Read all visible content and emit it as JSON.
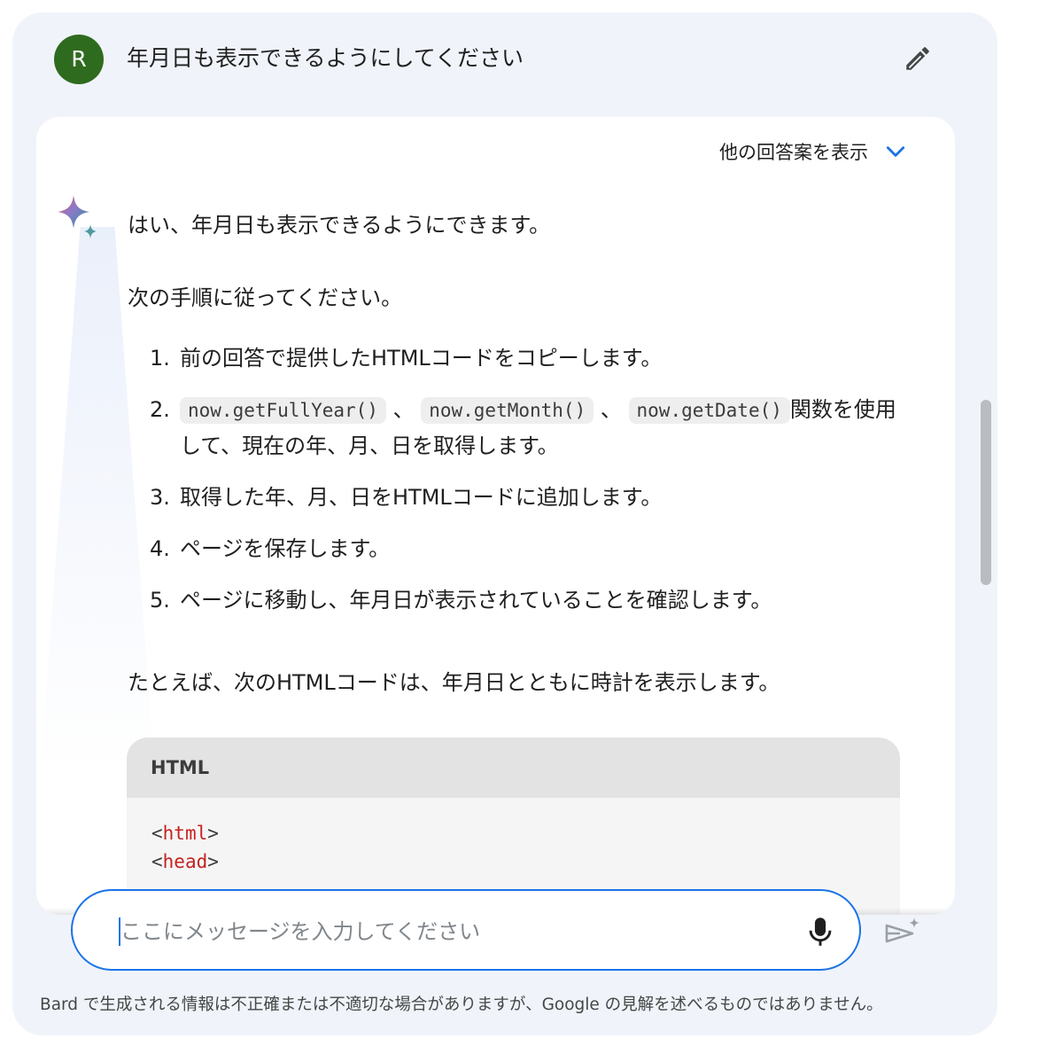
{
  "user": {
    "avatar_letter": "R",
    "prompt": "年月日も表示できるようにしてください"
  },
  "response": {
    "other_drafts_label": "他の回答案を表示",
    "intro": "はい、年月日も表示できるようにできます。",
    "steps_intro": "次の手順に従ってください。",
    "steps": [
      {
        "num": "1.",
        "text": "前の回答で提供したHTMLコードをコピーします。"
      },
      {
        "num": "2.",
        "code1": "now.getFullYear()",
        "sep1": "、",
        "code2": "now.getMonth()",
        "sep2": "、",
        "code3": "now.getDate()",
        "text": "関数を使用して、現在の年、月、日を取得します。"
      },
      {
        "num": "3.",
        "text": "取得した年、月、日をHTMLコードに追加します。"
      },
      {
        "num": "4.",
        "text": "ページを保存します。"
      },
      {
        "num": "5.",
        "text": "ページに移動し、年月日が表示されていることを確認します。"
      }
    ],
    "example_intro": "たとえば、次のHTMLコードは、年月日とともに時計を表示します。",
    "code_block": {
      "language": "HTML",
      "lines": [
        {
          "open": "<",
          "tag": "html",
          "close": ">"
        },
        {
          "open": "<",
          "tag": "head",
          "close": ">"
        }
      ]
    }
  },
  "input": {
    "placeholder": "ここにメッセージを入力してください"
  },
  "disclaimer": "Bard で生成される情報は不正確または不適切な場合がありますが、Google の見解を述べるものではありません。",
  "colors": {
    "accent": "#1a73e8",
    "avatar_bg": "#2f6b1f",
    "panel_bg": "#f0f4fa",
    "code_tag": "#c5221f"
  },
  "icons": {
    "edit": "pencil-icon",
    "expand": "chevron-down-icon",
    "assistant": "sparkle-icon",
    "mic": "microphone-icon",
    "send": "send-sparkle-icon"
  }
}
